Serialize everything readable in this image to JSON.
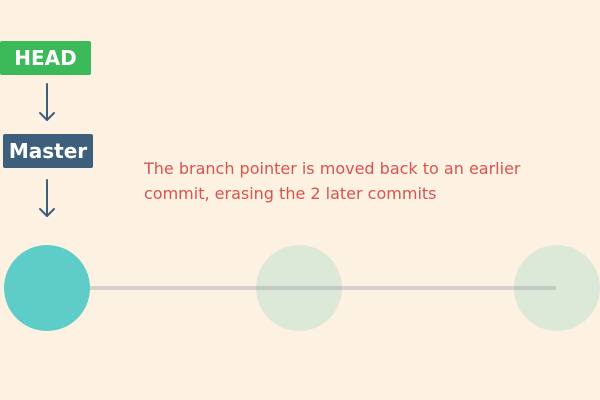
{
  "labels": {
    "head": "HEAD",
    "master": "Master"
  },
  "caption": {
    "line1": "The branch pointer is moved back to an earlier",
    "line2": "commit, erasing the 2 later commits"
  },
  "colors": {
    "background": "#fdf1e2",
    "head": "#3cba5a",
    "master": "#3d5f7c",
    "arrow": "#3d5f7c",
    "caption": "#d9534f",
    "commit_current": "#5ecdc7",
    "commit_erased": "#d6e8dc",
    "track": "#d6cfca"
  },
  "commits": [
    {
      "name": "commit-current",
      "state": "current"
    },
    {
      "name": "commit-erased-1",
      "state": "erased"
    },
    {
      "name": "commit-erased-2",
      "state": "erased"
    }
  ],
  "icons": {
    "arrow_1": "arrow-down-icon",
    "arrow_2": "arrow-down-icon"
  }
}
